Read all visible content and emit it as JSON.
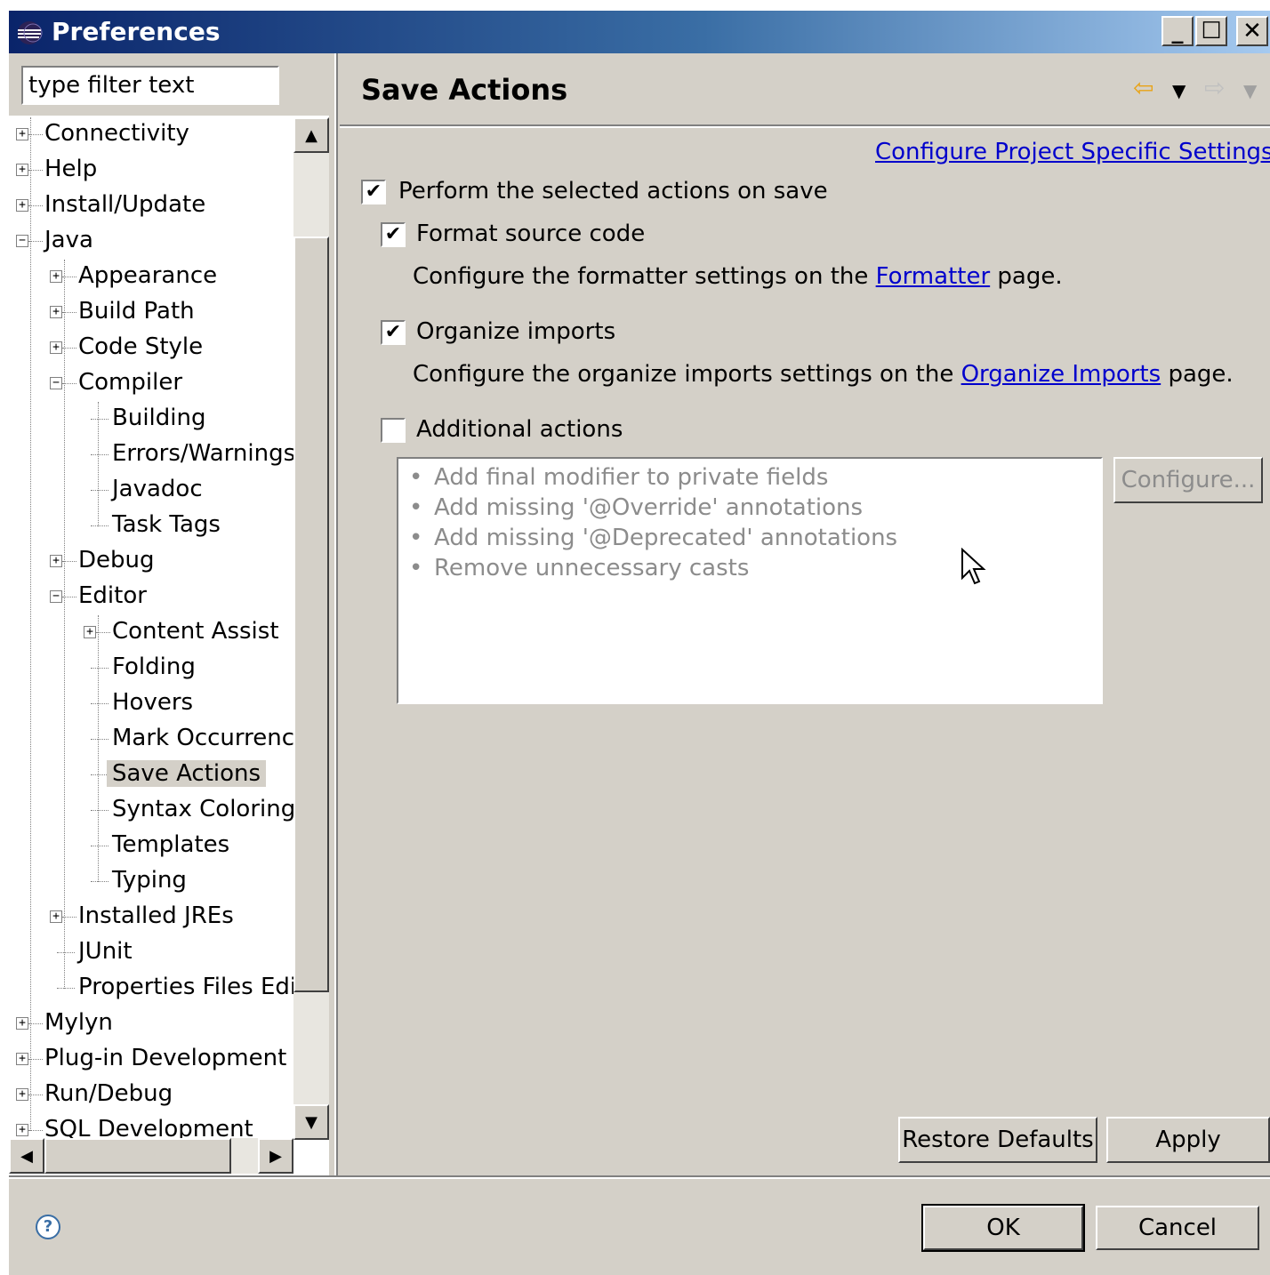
{
  "window": {
    "title": "Preferences",
    "minimize_label": "_",
    "maximize_label": "☐",
    "close_label": "✕"
  },
  "filter": {
    "value": "type filter text"
  },
  "tree": [
    {
      "label": "Connectivity",
      "depth": 0,
      "toggle": "+"
    },
    {
      "label": "Help",
      "depth": 0,
      "toggle": "+"
    },
    {
      "label": "Install/Update",
      "depth": 0,
      "toggle": "+"
    },
    {
      "label": "Java",
      "depth": 0,
      "toggle": "-"
    },
    {
      "label": "Appearance",
      "depth": 1,
      "toggle": "+"
    },
    {
      "label": "Build Path",
      "depth": 1,
      "toggle": "+"
    },
    {
      "label": "Code Style",
      "depth": 1,
      "toggle": "+"
    },
    {
      "label": "Compiler",
      "depth": 1,
      "toggle": "-"
    },
    {
      "label": "Building",
      "depth": 2,
      "toggle": ""
    },
    {
      "label": "Errors/Warnings",
      "depth": 2,
      "toggle": ""
    },
    {
      "label": "Javadoc",
      "depth": 2,
      "toggle": ""
    },
    {
      "label": "Task Tags",
      "depth": 2,
      "toggle": ""
    },
    {
      "label": "Debug",
      "depth": 1,
      "toggle": "+"
    },
    {
      "label": "Editor",
      "depth": 1,
      "toggle": "-"
    },
    {
      "label": "Content Assist",
      "depth": 2,
      "toggle": "+"
    },
    {
      "label": "Folding",
      "depth": 2,
      "toggle": ""
    },
    {
      "label": "Hovers",
      "depth": 2,
      "toggle": ""
    },
    {
      "label": "Mark Occurrences",
      "depth": 2,
      "toggle": ""
    },
    {
      "label": "Save Actions",
      "depth": 2,
      "toggle": "",
      "selected": true
    },
    {
      "label": "Syntax Coloring",
      "depth": 2,
      "toggle": ""
    },
    {
      "label": "Templates",
      "depth": 2,
      "toggle": ""
    },
    {
      "label": "Typing",
      "depth": 2,
      "toggle": ""
    },
    {
      "label": "Installed JREs",
      "depth": 1,
      "toggle": "+"
    },
    {
      "label": "JUnit",
      "depth": 1,
      "toggle": ""
    },
    {
      "label": "Properties Files Editor",
      "depth": 1,
      "toggle": ""
    },
    {
      "label": "Mylyn",
      "depth": 0,
      "toggle": "+"
    },
    {
      "label": "Plug-in Development",
      "depth": 0,
      "toggle": "+"
    },
    {
      "label": "Run/Debug",
      "depth": 0,
      "toggle": "+"
    },
    {
      "label": "SQL Development",
      "depth": 0,
      "toggle": "+"
    }
  ],
  "page": {
    "title": "Save Actions",
    "project_link": "Configure Project Specific Settings...",
    "perform_on_save": {
      "label": "Perform the selected actions on save",
      "checked": "✔"
    },
    "format_source": {
      "label": "Format source code",
      "checked": "✔"
    },
    "formatter_text_before": "Configure the formatter settings on the ",
    "formatter_link": "Formatter",
    "formatter_text_after": " page.",
    "organize_imports": {
      "label": "Organize imports",
      "checked": "✔"
    },
    "organize_text_before": "Configure the organize imports settings on the ",
    "organize_link": "Organize Imports",
    "organize_text_after": " page.",
    "additional_actions": {
      "label": "Additional actions",
      "checked": ""
    },
    "actions": [
      "Add final modifier to private fields",
      "Add missing '@Override' annotations",
      "Add missing '@Deprecated' annotations",
      "Remove unnecessary casts"
    ],
    "configure_button": "Configure...",
    "restore_defaults": "Restore Defaults",
    "apply": "Apply"
  },
  "footer": {
    "help_label": "?",
    "ok": "OK",
    "cancel": "Cancel"
  },
  "nav": {
    "back": "⇦",
    "back_menu": "▼",
    "forward": "⇨",
    "forward_menu": "▼"
  },
  "colors": {
    "title_bar": "#0a246a",
    "dialog_bg": "#d4d0c8",
    "link": "#0000cc",
    "disabled_text": "#8c8c8c"
  }
}
